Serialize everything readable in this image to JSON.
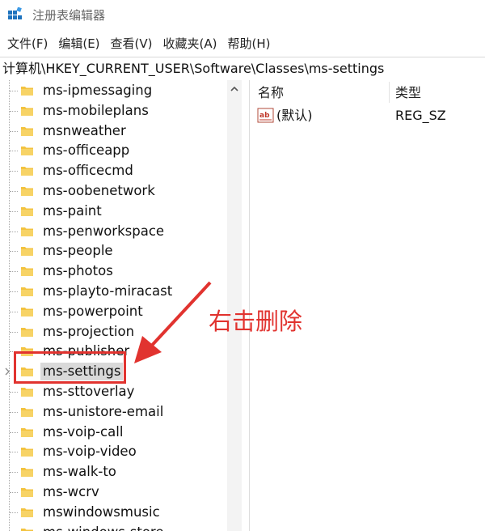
{
  "window": {
    "title": "注册表编辑器"
  },
  "menu": {
    "items": [
      "文件(F)",
      "编辑(E)",
      "查看(V)",
      "收藏夹(A)",
      "帮助(H)"
    ]
  },
  "address": {
    "path": "计算机\\HKEY_CURRENT_USER\\Software\\Classes\\ms-settings"
  },
  "tree": {
    "items": [
      {
        "label": "ms-ipmessaging"
      },
      {
        "label": "ms-mobileplans"
      },
      {
        "label": "msnweather"
      },
      {
        "label": "ms-officeapp"
      },
      {
        "label": "ms-officecmd"
      },
      {
        "label": "ms-oobenetwork"
      },
      {
        "label": "ms-paint"
      },
      {
        "label": "ms-penworkspace"
      },
      {
        "label": "ms-people"
      },
      {
        "label": "ms-photos"
      },
      {
        "label": "ms-playto-miracast"
      },
      {
        "label": "ms-powerpoint"
      },
      {
        "label": "ms-projection"
      },
      {
        "label": "ms-publisher"
      },
      {
        "label": "ms-settings",
        "selected": true,
        "has_children": true
      },
      {
        "label": "ms-sttoverlay"
      },
      {
        "label": "ms-unistore-email"
      },
      {
        "label": "ms-voip-call"
      },
      {
        "label": "ms-voip-video"
      },
      {
        "label": "ms-walk-to"
      },
      {
        "label": "ms-wcrv"
      },
      {
        "label": "mswindowsmusic"
      },
      {
        "label": "ms-windows-store"
      }
    ]
  },
  "values": {
    "headers": {
      "name": "名称",
      "type": "类型"
    },
    "rows": [
      {
        "icon": "string-value-icon",
        "name": "(默认)",
        "type": "REG_SZ"
      }
    ]
  },
  "annotation": {
    "text": "右击删除",
    "color": "#e1332f"
  },
  "colors": {
    "folder": "#f3c340",
    "accent_red": "#e1332f"
  }
}
